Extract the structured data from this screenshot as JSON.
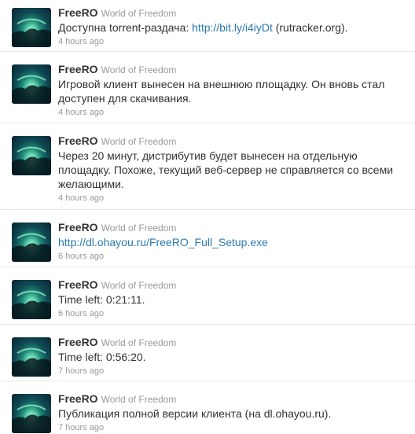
{
  "tweets": [
    {
      "screen_name": "FreeRO",
      "full_name": "World of Freedom",
      "text_before": "Доступна torrent-раздача: ",
      "link": "http://bit.ly/i4iyDt",
      "text_after": " (rutracker.org).",
      "time": "4 hours ago"
    },
    {
      "screen_name": "FreeRO",
      "full_name": "World of Freedom",
      "text_before": "Игровой клиент вынесен на внешнюю площадку. Он вновь стал доступен для скачивания.",
      "link": "",
      "text_after": "",
      "time": "4 hours ago"
    },
    {
      "screen_name": "FreeRO",
      "full_name": "World of Freedom",
      "text_before": "Через 20 минут, дистрибутив будет вынесен на отдельную площадку. Похоже, текущий веб-сервер не справляется со всеми желающими.",
      "link": "",
      "text_after": "",
      "time": "4 hours ago"
    },
    {
      "screen_name": "FreeRO",
      "full_name": "World of Freedom",
      "text_before": "",
      "link": "http://dl.ohayou.ru/FreeRO_Full_Setup.exe",
      "text_after": "",
      "time": "6 hours ago"
    },
    {
      "screen_name": "FreeRO",
      "full_name": "World of Freedom",
      "text_before": "Time left: 0:21:11.",
      "link": "",
      "text_after": "",
      "time": "6 hours ago"
    },
    {
      "screen_name": "FreeRO",
      "full_name": "World of Freedom",
      "text_before": "Time left: 0:56:20.",
      "link": "",
      "text_after": "",
      "time": "7 hours ago"
    },
    {
      "screen_name": "FreeRO",
      "full_name": "World of Freedom",
      "text_before": "Публикация полной версии клиента (на dl.ohayou.ru).",
      "link": "",
      "text_after": "",
      "time": "7 hours ago"
    }
  ],
  "avatar_icon": "aurora-landscape-icon"
}
